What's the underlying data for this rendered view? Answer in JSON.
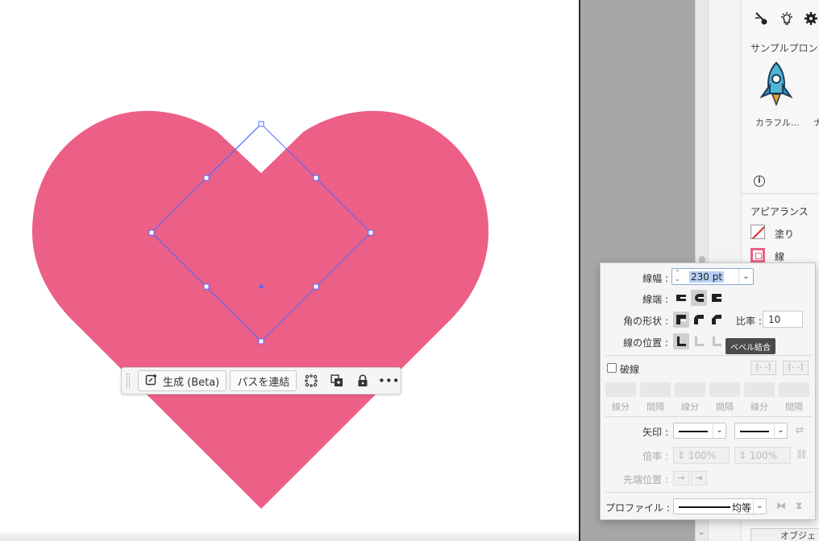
{
  "context_bar": {
    "generate_label": "生成 (Beta)",
    "join_path_label": "パスを連結",
    "icons": [
      "ai-generate-icon",
      "isolate-icon",
      "group-icon",
      "lock-icon",
      "more-icon"
    ],
    "more_glyph": "•••"
  },
  "right_panel": {
    "sample_prompt_title": "サンプルプロンプ",
    "sample_card_label": "カラフル...",
    "sample_card_label_2": "ナ",
    "appearance_title": "アピアランス",
    "fill_label": "塗り",
    "stroke_label": "線",
    "object_tab": "オブジェ",
    "info_glyph": "i"
  },
  "stroke_panel": {
    "weight_label": "線幅 :",
    "weight_value": "230 pt",
    "cap_label": "線端 :",
    "corner_label": "角の形状 :",
    "limit_label": "比率 :",
    "limit_value": "10",
    "align_label": "線の位置 :",
    "tooltip": "ベベル結合",
    "dash_label": "破線",
    "dash_cells": [
      "線分",
      "間隔",
      "線分",
      "間隔",
      "線分",
      "間隔"
    ],
    "arrow_label": "矢印 :",
    "scale_label": "倍率 :",
    "scale_value_1": "100%",
    "scale_value_2": "100%",
    "tip_label": "先端位置 :",
    "profile_label": "プロファイル :",
    "profile_value": "均等"
  },
  "colors": {
    "heart_fill": "#ec5f86",
    "selection": "#4f6bff",
    "pasteboard": "#a7a7a7"
  }
}
